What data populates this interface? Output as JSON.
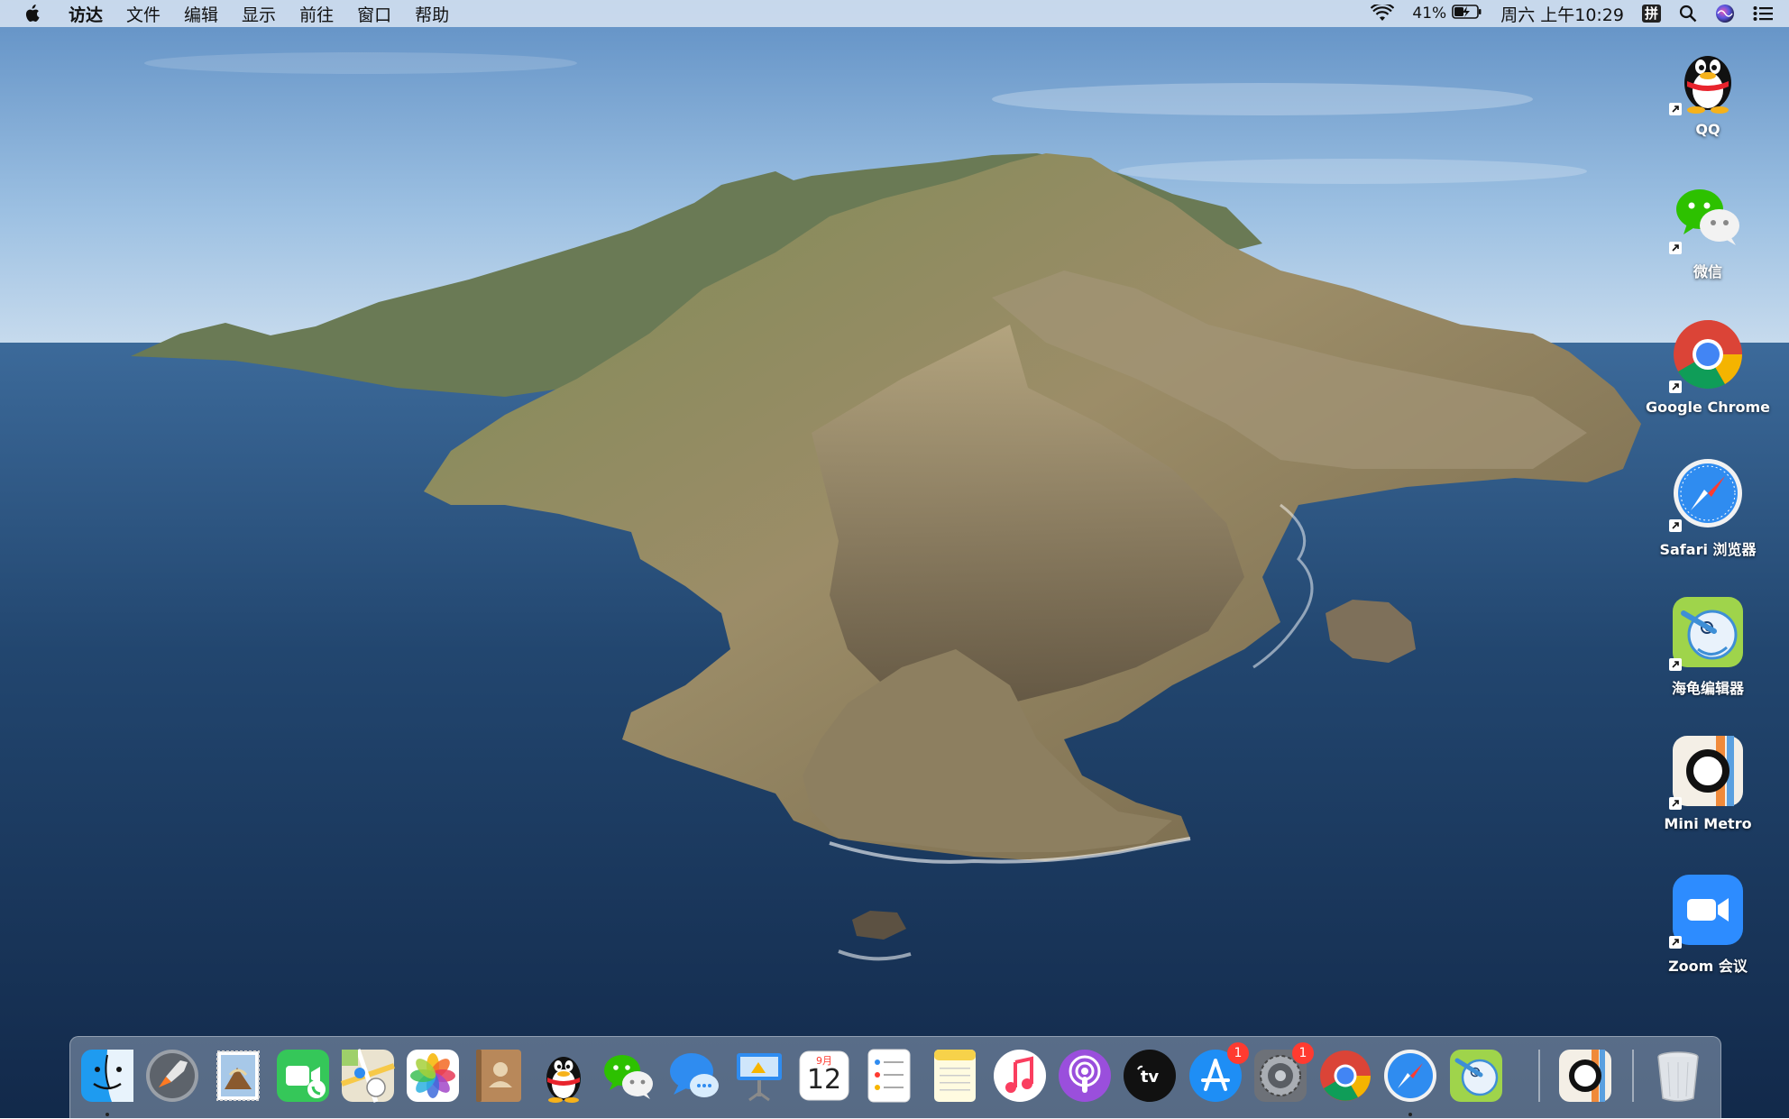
{
  "menubar": {
    "app_name": "访达",
    "menus": [
      "文件",
      "编辑",
      "显示",
      "前往",
      "窗口",
      "帮助"
    ],
    "battery_percent": "41%",
    "datetime": "周六 上午10:29",
    "input_method": "拼"
  },
  "desktop_icons": [
    {
      "label": "QQ",
      "icon": "qq-penguin-icon"
    },
    {
      "label": "微信",
      "icon": "wechat-icon"
    },
    {
      "label": "Google Chrome",
      "icon": "chrome-icon"
    },
    {
      "label": "Safari 浏览器",
      "icon": "safari-icon"
    },
    {
      "label": "海龟编辑器",
      "icon": "turtle-editor-icon"
    },
    {
      "label": "Mini Metro",
      "icon": "mini-metro-icon"
    },
    {
      "label": "Zoom 会议",
      "icon": "zoom-icon"
    }
  ],
  "dock": {
    "calendar_month": "9月",
    "calendar_day": "12",
    "appstore_badge": "1",
    "settings_badge": "1",
    "items": [
      "finder",
      "launchpad",
      "mail",
      "facetime",
      "maps",
      "photos",
      "contacts",
      "qq",
      "wechat",
      "messages",
      "keynote",
      "calendar",
      "reminders",
      "notes",
      "music",
      "podcasts",
      "tv",
      "app-store",
      "system-preferences",
      "chrome",
      "safari",
      "turtle-editor",
      "mini-metro",
      "trash"
    ],
    "running": [
      "finder",
      "safari"
    ]
  },
  "colors": {
    "sky": "#8fb6dc",
    "ocean": "#1d3d66",
    "island": "#8a7c5a",
    "badge": "#ff3b30"
  }
}
